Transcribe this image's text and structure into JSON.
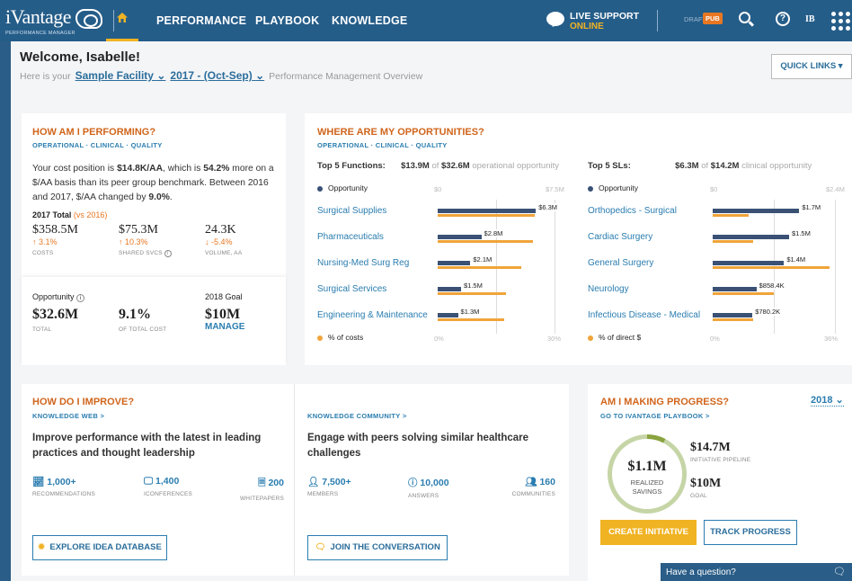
{
  "nav": {
    "logo": "iVantage",
    "logo_sub": "PERFORMANCE MANAGER",
    "links": [
      "PERFORMANCE",
      "PLAYBOOK",
      "KNOWLEDGE"
    ],
    "live_support": "LIVE SUPPORT",
    "live_status": "ONLINE",
    "draft": "DRAFT",
    "pub": "PUB",
    "initials": "IB"
  },
  "welcome": {
    "title": "Welcome, Isabelle!",
    "prefix": "Here is your",
    "facility": "Sample Facility",
    "period": "2017 - (Oct-Sep)",
    "suffix": "Performance Management Overview",
    "quick_links": "QUICK LINKS ▾"
  },
  "perf": {
    "title": "HOW AM I PERFORMING?",
    "sub": "OPERATIONAL · CLINICAL · QUALITY",
    "body_1": "Your cost position is ",
    "body_2": "$14.8K/AA",
    "body_3": ", which is ",
    "body_4": "54.2%",
    "body_5": " more on a $/AA basis than its peer group benchmark. Between 2016 and 2017, $/AA changed by ",
    "body_6": "9.0%",
    "body_7": ".",
    "total_label": "2017 Total",
    "vs": "(vs 2016)",
    "stats": [
      {
        "value": "$358.5M",
        "change": "↑ 3.1%",
        "label": "COSTS"
      },
      {
        "value": "$75.3M",
        "change": "↑ 10.3%",
        "label": "SHARED SVCS"
      },
      {
        "value": "24.3K",
        "change": "↓ -5.4%",
        "label": "VOLUME, AA"
      }
    ],
    "opp_label": "Opportunity",
    "goal_label": "2018 Goal",
    "opp_value": "$32.6M",
    "opp_value_label": "TOTAL",
    "pct_value": "9.1%",
    "pct_label": "OF TOTAL COST",
    "goal_value": "$10M",
    "manage": "MANAGE"
  },
  "opps": {
    "title": "WHERE ARE MY OPPORTUNITIES?",
    "sub": "OPERATIONAL · CLINICAL · QUALITY",
    "functions_label": "Top 5 Functions:",
    "functions_amt": "$13.9M",
    "functions_of": "of",
    "functions_total": "$32.6M",
    "functions_tail": "operational opportunity",
    "sls_label": "Top 5 SLs:",
    "sls_amt": "$6.3M",
    "sls_of": "of",
    "sls_total": "$14.2M",
    "sls_tail": "clinical opportunity",
    "legend_opp": "Opportunity",
    "legend_costs": "% of costs",
    "legend_direct": "% of direct $",
    "axis_f_min": "$0",
    "axis_f_max": "$7.5M",
    "axis_f_pmin": "0%",
    "axis_f_pmax": "30%",
    "axis_s_min": "$0",
    "axis_s_max": "$2.4M",
    "axis_s_pmin": "0%",
    "axis_s_pmax": "36%"
  },
  "chart_data": [
    {
      "type": "bar",
      "title": "Top 5 Functions",
      "categories": [
        "Surgical Supplies",
        "Pharmaceuticals",
        "Nursing-Med Surg Reg",
        "Surgical Services",
        "Engineering & Maintenance"
      ],
      "series": [
        {
          "name": "Opportunity",
          "values": [
            6.3,
            2.8,
            2.1,
            1.5,
            1.3
          ],
          "labels": [
            "$6.3M",
            "$2.8M",
            "$2.1M",
            "$1.5M",
            "$1.3M"
          ],
          "color": "#3a5175"
        },
        {
          "name": "% of costs",
          "values": [
            25,
            24.5,
            21.5,
            17.5,
            17
          ],
          "color": "#f0a43a"
        }
      ],
      "xlim": [
        0,
        7.5
      ],
      "x2lim": [
        0,
        30
      ]
    },
    {
      "type": "bar",
      "title": "Top 5 SLs",
      "categories": [
        "Orthopedics - Surgical",
        "Cardiac Surgery",
        "General Surgery",
        "Neurology",
        "Infectious Disease - Medical"
      ],
      "series": [
        {
          "name": "Opportunity",
          "values": [
            1.7,
            1.5,
            1.4,
            0.8584,
            0.7802
          ],
          "labels": [
            "$1.7M",
            "$1.5M",
            "$1.4M",
            "$858.4K",
            "$780.2K"
          ],
          "color": "#3a5175"
        },
        {
          "name": "% of direct $",
          "values": [
            10.5,
            12,
            34.5,
            18,
            12
          ],
          "color": "#f0a43a"
        }
      ],
      "xlim": [
        0,
        2.4
      ],
      "x2lim": [
        0,
        36
      ]
    }
  ],
  "improve": {
    "title": "HOW DO I IMPROVE?",
    "web": "KNOWLEDGE WEB  >",
    "web_text": "Improve performance with the latest in leading practices and thought leadership",
    "web_stats": [
      {
        "value": "1,000+",
        "label": "RECOMMENDATIONS"
      },
      {
        "value": "1,400",
        "label": "ICONFERENCES"
      },
      {
        "value": "200",
        "label": "WHITEPAPERS"
      }
    ],
    "explore": "EXPLORE IDEA DATABASE",
    "community": "KNOWLEDGE COMMUNITY >",
    "community_text": "Engage with peers solving similar healthcare challenges",
    "community_stats": [
      {
        "value": "7,500+",
        "label": "MEMBERS"
      },
      {
        "value": "10,000",
        "label": "ANSWERS"
      },
      {
        "value": "160",
        "label": "COMMUNITIES"
      }
    ],
    "join": "JOIN THE CONVERSATION"
  },
  "progress": {
    "title": "AM I MAKING PROGRESS?",
    "link": "GO TO IVANTAGE PLAYBOOK  >",
    "year": "2018",
    "ring_value": "$1.1M",
    "ring_label1": "REALIZED",
    "ring_label2": "SAVINGS",
    "pipeline_value": "$14.7M",
    "pipeline_label": "INITIATIVE PIPELINE",
    "goal_value": "$10M",
    "goal_label": "GOAL",
    "create": "CREATE INITIATIVE",
    "track": "TRACK PROGRESS"
  },
  "question": "Have a question?"
}
